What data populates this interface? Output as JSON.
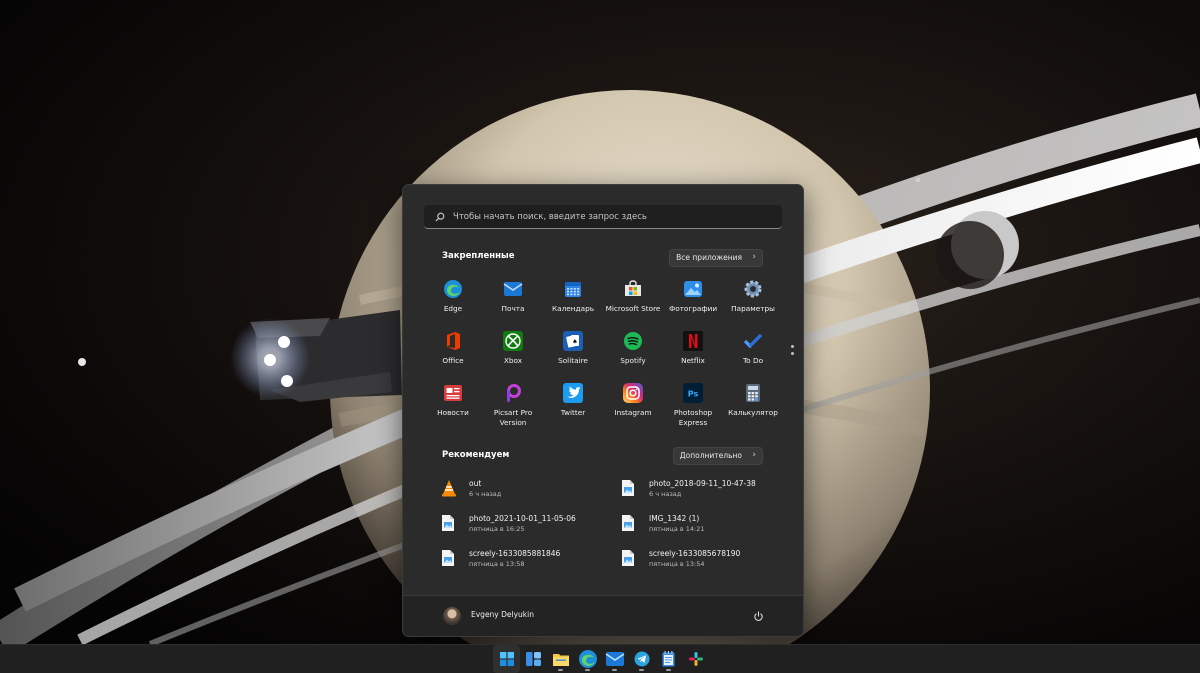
{
  "search": {
    "placeholder": "Чтобы начать поиск, введите запрос здесь",
    "icon": "search-icon"
  },
  "pinned": {
    "title": "Закрепленные",
    "all_apps_label": "Все приложения",
    "apps": [
      {
        "label": "Edge",
        "icon": "edge-icon",
        "color": "#2aa5e0"
      },
      {
        "label": "Почта",
        "icon": "mail-icon",
        "color": "#1c78d6"
      },
      {
        "label": "Календарь",
        "icon": "calendar-icon",
        "color": "#2d84e5"
      },
      {
        "label": "Microsoft Store",
        "icon": "store-icon",
        "color": "#f25022"
      },
      {
        "label": "Фотографии",
        "icon": "photos-icon",
        "color": "#2f8ee8"
      },
      {
        "label": "Параметры",
        "icon": "gear-icon",
        "color": "#4a7fb7"
      },
      {
        "label": "Office",
        "icon": "office-icon",
        "color": "#e8483b"
      },
      {
        "label": "Xbox",
        "icon": "xbox-icon",
        "color": "#107c10"
      },
      {
        "label": "Solitaire",
        "icon": "solitaire-icon",
        "color": "#1a5fb4"
      },
      {
        "label": "Spotify",
        "icon": "spotify-icon",
        "color": "#1db954"
      },
      {
        "label": "Netflix",
        "icon": "netflix-icon",
        "color": "#e50914"
      },
      {
        "label": "To Do",
        "icon": "todo-icon",
        "color": "#2e73d9"
      },
      {
        "label": "Новости",
        "icon": "news-icon",
        "color": "#d73b3b"
      },
      {
        "label": "Picsart Pro Version",
        "icon": "picsart-icon",
        "color": "#c341d6"
      },
      {
        "label": "Twitter",
        "icon": "twitter-icon",
        "color": "#1d9bf0"
      },
      {
        "label": "Instagram",
        "icon": "instagram-icon",
        "color": "#d6249f"
      },
      {
        "label": "Photoshop Express",
        "icon": "photoshop-icon",
        "color": "#31a8ff"
      },
      {
        "label": "Калькулятор",
        "icon": "calculator-icon",
        "color": "#7a8da3"
      }
    ]
  },
  "recommended": {
    "title": "Рекомендуем",
    "more_label": "Дополнительно",
    "items": [
      {
        "name": "out",
        "time": "6 ч назад",
        "icon": "vlc-icon"
      },
      {
        "name": "photo_2018-09-11_10-47-38",
        "time": "6 ч назад",
        "icon": "image-file-icon"
      },
      {
        "name": "photo_2021-10-01_11-05-06",
        "time": "пятница в 16:25",
        "icon": "image-file-icon"
      },
      {
        "name": "IMG_1342 (1)",
        "time": "пятница в 14:21",
        "icon": "image-file-icon"
      },
      {
        "name": "screely-1633085881846",
        "time": "пятница в 13:58",
        "icon": "image-file-icon"
      },
      {
        "name": "screely-1633085678190",
        "time": "пятница в 13:54",
        "icon": "image-file-icon"
      }
    ]
  },
  "footer": {
    "user_name": "Evgeny Delyukin",
    "power_icon": "power-icon"
  },
  "taskbar": {
    "items": [
      {
        "icon": "start-icon",
        "state": "active"
      },
      {
        "icon": "widgets-icon",
        "state": ""
      },
      {
        "icon": "file-explorer-icon",
        "state": "running"
      },
      {
        "icon": "edge-icon",
        "state": "running"
      },
      {
        "icon": "mail-icon",
        "state": "running"
      },
      {
        "icon": "telegram-icon",
        "state": "running"
      },
      {
        "icon": "notepad-icon",
        "state": "running"
      },
      {
        "icon": "slack-icon",
        "state": ""
      }
    ]
  }
}
